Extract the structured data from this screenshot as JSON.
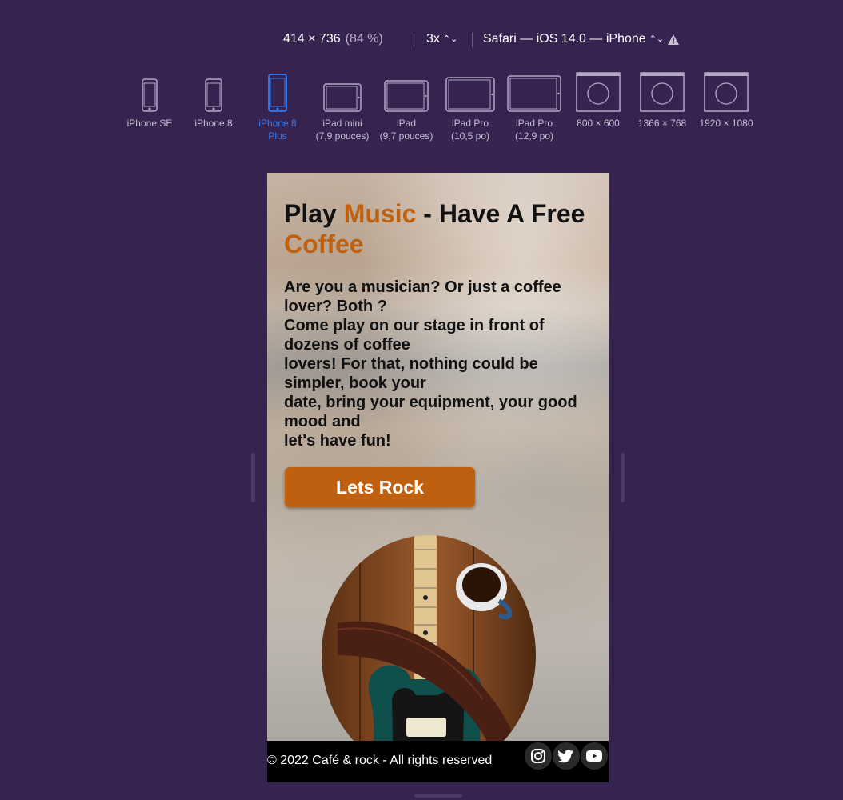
{
  "toolbar": {
    "viewport_size": "414 × 736",
    "zoom": "(84 %)",
    "pixel_ratio": "3x",
    "browser": "Safari — iOS 14.0 — iPhone",
    "chevron": "⌃⌄",
    "warning_icon": "warning-triangle-icon"
  },
  "devices": [
    {
      "label": "iPhone SE",
      "sublabel": "",
      "icon": "phone-icon"
    },
    {
      "label": "iPhone 8",
      "sublabel": "",
      "icon": "phone-icon"
    },
    {
      "label": "iPhone 8",
      "sublabel": "Plus",
      "icon": "phone-icon",
      "active": true
    },
    {
      "label": "iPad mini",
      "sublabel": "(7,9 pouces)",
      "icon": "tablet-icon"
    },
    {
      "label": "iPad",
      "sublabel": "(9,7 pouces)",
      "icon": "tablet-icon"
    },
    {
      "label": "iPad Pro",
      "sublabel": "(10,5 po)",
      "icon": "tablet-icon"
    },
    {
      "label": "iPad Pro",
      "sublabel": "(12,9 po)",
      "icon": "tablet-icon"
    },
    {
      "label": "800 × 600",
      "sublabel": "",
      "icon": "safari-window-icon"
    },
    {
      "label": "1366 × 768",
      "sublabel": "",
      "icon": "safari-window-icon"
    },
    {
      "label": "1920 × 1080",
      "sublabel": "",
      "icon": "safari-window-icon"
    }
  ],
  "page": {
    "headline_play": "Play ",
    "headline_music": "Music",
    "headline_mid": " - Have A Free ",
    "headline_coffee": "Coffee",
    "description": "Are you a musician? Or just a coffee lover? Both ?\nCome play on our stage in front of dozens of coffee\nlovers! For that, nothing could be simpler, book your\ndate, bring your equipment, your good mood and\nlet's have fun!",
    "cta_label": "Lets Rock",
    "footer_text": "© 2022 Café & rock - All rights reserved",
    "social": [
      "instagram-icon",
      "twitter-icon",
      "youtube-icon"
    ]
  },
  "colors": {
    "background": "#372350",
    "accent": "#c0610f",
    "active_device": "#2f7cf6",
    "footer": "#000000"
  }
}
